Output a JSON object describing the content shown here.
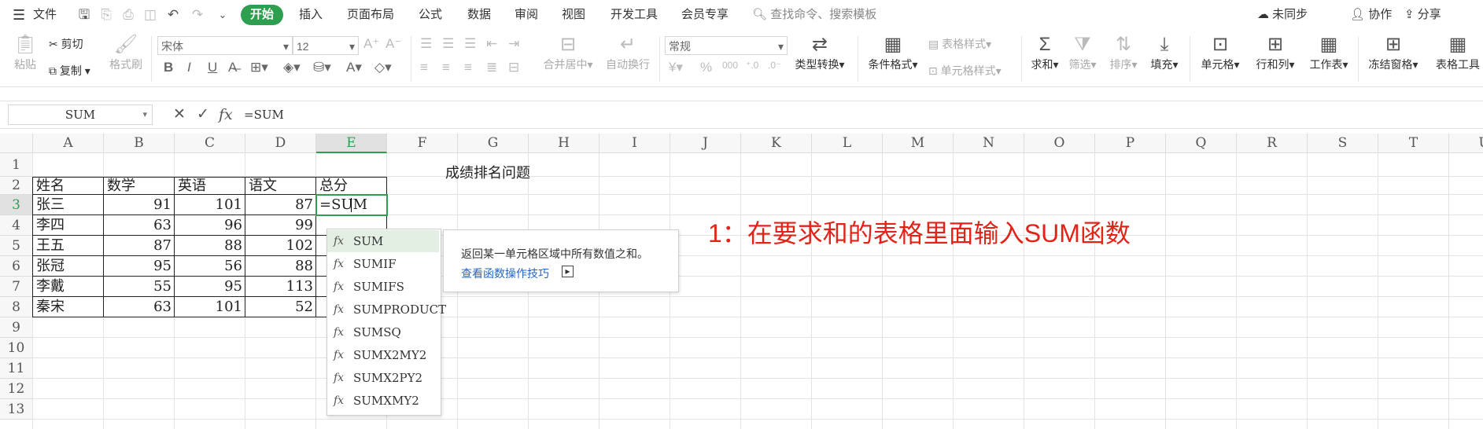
{
  "menubar": {
    "file_label": "文件",
    "tabs": [
      "开始",
      "插入",
      "页面布局",
      "公式",
      "数据",
      "审阅",
      "视图",
      "开发工具",
      "会员专享"
    ],
    "search_placeholder": "查找命令、搜索模板",
    "sync_label": "未同步",
    "collab_label": "协作",
    "share_label": "分享"
  },
  "ribbon": {
    "paste": "粘贴",
    "cut": "剪切",
    "copy": "复制",
    "format_painter": "格式刷",
    "font_name": "宋体",
    "font_size": "12",
    "merge_center": "合并居中",
    "wrap_text": "自动换行",
    "number_format": "常规",
    "type_convert": "类型转换",
    "conditional_format": "条件格式",
    "table_style": "表格样式",
    "cell_style": "单元格样式",
    "sum": "求和",
    "filter": "筛选",
    "sort": "排序",
    "fill": "填充",
    "cell": "单元格",
    "row_col": "行和列",
    "worksheet": "工作表",
    "freeze": "冻结窗格",
    "table_tools": "表格工具",
    "percent": "%",
    "thousands": "000"
  },
  "formula_bar": {
    "name_box": "SUM",
    "formula": "=SUM"
  },
  "sheet": {
    "columns": [
      "A",
      "B",
      "C",
      "D",
      "E",
      "F",
      "G",
      "H",
      "I",
      "J",
      "K",
      "L",
      "M",
      "N",
      "O",
      "P",
      "Q",
      "R",
      "S",
      "T",
      "U"
    ],
    "rows": [
      "1",
      "2",
      "3",
      "4",
      "5",
      "6",
      "7",
      "8",
      "9",
      "10",
      "11",
      "12",
      "13"
    ],
    "title": "成绩排名问题",
    "headers": [
      "姓名",
      "数学",
      "英语",
      "语文",
      "总分"
    ],
    "data": [
      [
        "张三",
        "91",
        "101",
        "87"
      ],
      [
        "李四",
        "63",
        "96",
        "99"
      ],
      [
        "王五",
        "87",
        "88",
        "102"
      ],
      [
        "张冠",
        "95",
        "56",
        "88"
      ],
      [
        "李戴",
        "55",
        "95",
        "113"
      ],
      [
        "秦宋",
        "63",
        "101",
        "52"
      ]
    ],
    "active_cell_value": "=SUM"
  },
  "autocomplete": {
    "items": [
      "SUM",
      "SUMIF",
      "SUMIFS",
      "SUMPRODUCT",
      "SUMSQ",
      "SUMX2MY2",
      "SUMX2PY2",
      "SUMXMY2"
    ],
    "fx_label": "fx"
  },
  "tooltip": {
    "description": "返回某一单元格区域中所有数值之和。",
    "link": "查看函数操作技巧"
  },
  "annotation": "1：在要求和的表格里面输入SUM函数",
  "colors": {
    "accent": "#2e9e4f",
    "annotation": "#e2231a",
    "link": "#2566c1"
  }
}
